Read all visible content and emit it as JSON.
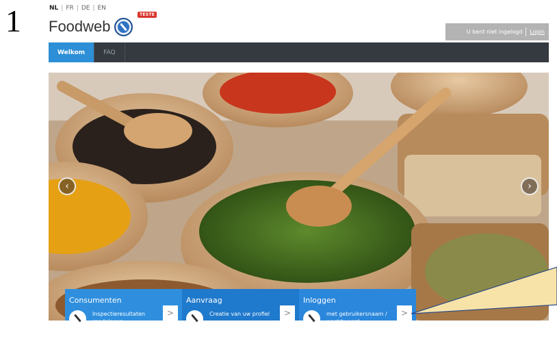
{
  "step_number": "1",
  "languages": [
    {
      "code": "NL",
      "active": true
    },
    {
      "code": "FR",
      "active": false
    },
    {
      "code": "DE",
      "active": false
    },
    {
      "code": "EN",
      "active": false
    }
  ],
  "brand": {
    "name": "Foodweb",
    "badge": "TESTE",
    "icon": "foodweb-logo-icon"
  },
  "account": {
    "status": "U bent niet ingelogd",
    "login_label": "Login"
  },
  "nav": {
    "tabs": [
      {
        "label": "Welkom",
        "active": true
      },
      {
        "label": "FAQ",
        "active": false
      }
    ]
  },
  "carousel": {
    "prev_icon": "chevron-left-icon",
    "next_icon": "chevron-right-icon"
  },
  "cards": [
    {
      "title": "Consumenten",
      "description": "Inspectieresultaten raadplegen",
      "icon": "foodweb-icon",
      "arrow": ">"
    },
    {
      "title": "Aanvraag",
      "description": "Creatie van uw profiel",
      "icon": "foodweb-icon",
      "arrow": ">"
    },
    {
      "title": "Inloggen",
      "description": "met gebruikersnaam / wachtwoord",
      "icon": "foodweb-icon",
      "arrow": ">"
    }
  ],
  "colors": {
    "nav_bg": "#343a40",
    "active_tab": "#2d8fd7",
    "card_blue": "#2f8fde",
    "badge_red": "#d9342b",
    "callout_fill": "#f7e3a8"
  }
}
